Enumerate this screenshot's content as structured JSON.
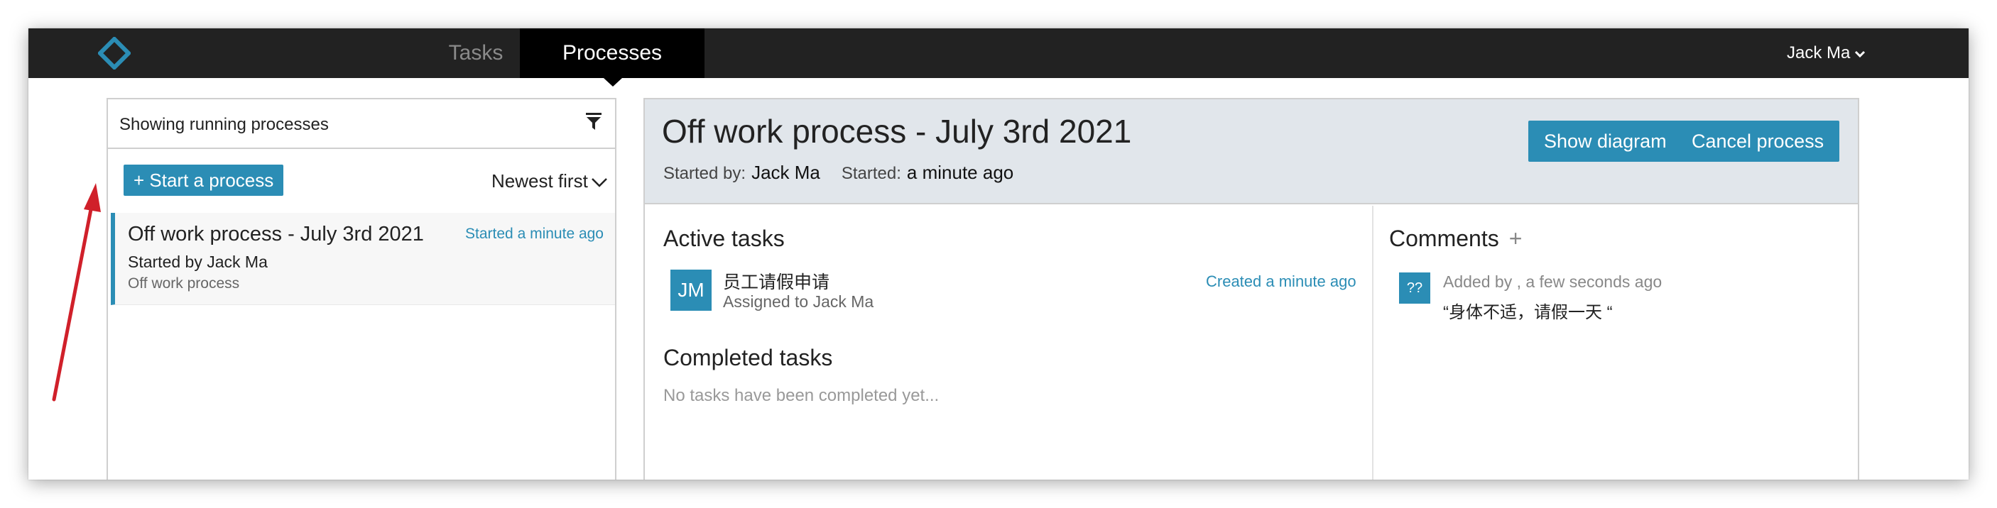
{
  "nav": {
    "tabs": [
      {
        "label": "Tasks",
        "active": false
      },
      {
        "label": "Processes",
        "active": true
      }
    ],
    "user": "Jack Ma",
    "logo_icon": "diamond-logo-icon"
  },
  "colors": {
    "accent": "#2b8db5",
    "topbar": "#222222",
    "header_bg": "#e1e6eb",
    "annotation_arrow": "#d0202a"
  },
  "process_list": {
    "filter_text": "Showing running processes",
    "start_button": "+ Start a process",
    "sort_label": "Newest first",
    "items": [
      {
        "title": "Off work process - July 3rd 2021",
        "time": "Started a minute ago",
        "started_by": "Started by Jack Ma",
        "definition": "Off work process"
      }
    ]
  },
  "process_detail": {
    "title": "Off work process - July 3rd 2021",
    "started_by_label": "Started by:",
    "started_by_value": "Jack Ma",
    "started_label": "Started:",
    "started_value": "a minute ago",
    "show_diagram_button": "Show diagram",
    "cancel_button": "Cancel process",
    "active_tasks_title": "Active tasks",
    "active_tasks": [
      {
        "avatar": "JM",
        "name": "员工请假申请",
        "assignee": "Assigned to Jack Ma",
        "created": "Created a minute ago"
      }
    ],
    "completed_tasks_title": "Completed tasks",
    "completed_empty": "No tasks have been completed yet...",
    "comments_title": "Comments",
    "comments_add": "+",
    "comments": [
      {
        "avatar": "??",
        "by": "Added by , a few seconds ago",
        "text": "“身体不适，请假一天 “"
      }
    ]
  }
}
